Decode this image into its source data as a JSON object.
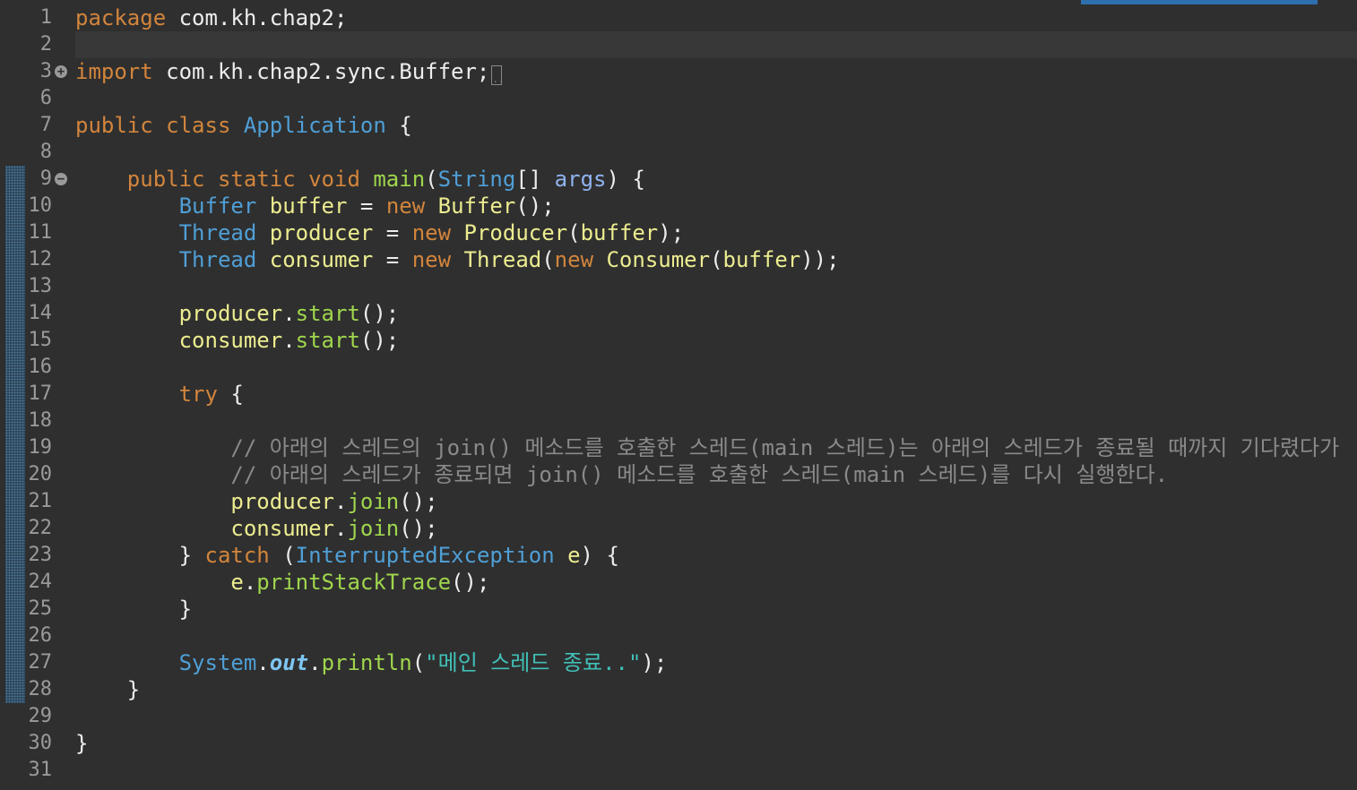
{
  "editor": {
    "colors": {
      "background": "#2f2f2f",
      "keyword": "#d2853c",
      "type": "#4f9fd6",
      "variable": "#ecec90",
      "method": "#9fd64d",
      "comment": "#8a8a8a",
      "string": "#40c0b8",
      "line_number": "#9a9a9a"
    },
    "lines": [
      {
        "n": "1",
        "tokens": [
          [
            "kw",
            "package"
          ],
          [
            "plain",
            " com.kh.chap2;"
          ]
        ]
      },
      {
        "n": "2",
        "tokens": [],
        "current": true
      },
      {
        "n": "3",
        "fold": "expand",
        "tokens": [
          [
            "kw",
            "import"
          ],
          [
            "plain",
            " com.kh.chap2.sync.Buffer;"
          ],
          [
            "box",
            ".."
          ]
        ]
      },
      {
        "n": "6",
        "tokens": []
      },
      {
        "n": "7",
        "tokens": [
          [
            "kw",
            "public"
          ],
          [
            "plain",
            " "
          ],
          [
            "kw",
            "class"
          ],
          [
            "plain",
            " "
          ],
          [
            "type",
            "Application"
          ],
          [
            "plain",
            " {"
          ]
        ]
      },
      {
        "n": "8",
        "tokens": []
      },
      {
        "n": "9",
        "fold": "collapse",
        "change": true,
        "tokens": [
          [
            "plain",
            "    "
          ],
          [
            "kw",
            "public"
          ],
          [
            "plain",
            " "
          ],
          [
            "kw",
            "static"
          ],
          [
            "plain",
            " "
          ],
          [
            "kw",
            "void"
          ],
          [
            "plain",
            " "
          ],
          [
            "method",
            "main"
          ],
          [
            "plain",
            "("
          ],
          [
            "type",
            "String"
          ],
          [
            "plain",
            "[] "
          ],
          [
            "param",
            "args"
          ],
          [
            "plain",
            ") {"
          ]
        ]
      },
      {
        "n": "10",
        "change": true,
        "tokens": [
          [
            "plain",
            "        "
          ],
          [
            "type",
            "Buffer"
          ],
          [
            "plain",
            " "
          ],
          [
            "var",
            "buffer"
          ],
          [
            "plain",
            " = "
          ],
          [
            "kw",
            "new"
          ],
          [
            "plain",
            " "
          ],
          [
            "var",
            "Buffer"
          ],
          [
            "plain",
            "();"
          ]
        ]
      },
      {
        "n": "11",
        "change": true,
        "tokens": [
          [
            "plain",
            "        "
          ],
          [
            "type",
            "Thread"
          ],
          [
            "plain",
            " "
          ],
          [
            "var",
            "producer"
          ],
          [
            "plain",
            " = "
          ],
          [
            "kw",
            "new"
          ],
          [
            "plain",
            " "
          ],
          [
            "var",
            "Producer"
          ],
          [
            "plain",
            "("
          ],
          [
            "var",
            "buffer"
          ],
          [
            "plain",
            ");"
          ]
        ]
      },
      {
        "n": "12",
        "change": true,
        "tokens": [
          [
            "plain",
            "        "
          ],
          [
            "type",
            "Thread"
          ],
          [
            "plain",
            " "
          ],
          [
            "var",
            "consumer"
          ],
          [
            "plain",
            " = "
          ],
          [
            "kw",
            "new"
          ],
          [
            "plain",
            " "
          ],
          [
            "var",
            "Thread"
          ],
          [
            "plain",
            "("
          ],
          [
            "kw",
            "new"
          ],
          [
            "plain",
            " "
          ],
          [
            "var",
            "Consumer"
          ],
          [
            "plain",
            "("
          ],
          [
            "var",
            "buffer"
          ],
          [
            "plain",
            "));"
          ]
        ]
      },
      {
        "n": "13",
        "change": true,
        "tokens": []
      },
      {
        "n": "14",
        "change": true,
        "tokens": [
          [
            "plain",
            "        "
          ],
          [
            "var",
            "producer"
          ],
          [
            "plain",
            "."
          ],
          [
            "method",
            "start"
          ],
          [
            "plain",
            "();"
          ]
        ]
      },
      {
        "n": "15",
        "change": true,
        "tokens": [
          [
            "plain",
            "        "
          ],
          [
            "var",
            "consumer"
          ],
          [
            "plain",
            "."
          ],
          [
            "method",
            "start"
          ],
          [
            "plain",
            "();"
          ]
        ]
      },
      {
        "n": "16",
        "change": true,
        "tokens": []
      },
      {
        "n": "17",
        "change": true,
        "tokens": [
          [
            "plain",
            "        "
          ],
          [
            "kw",
            "try"
          ],
          [
            "plain",
            " {"
          ]
        ]
      },
      {
        "n": "18",
        "change": true,
        "tokens": []
      },
      {
        "n": "19",
        "change": true,
        "tokens": [
          [
            "plain",
            "            "
          ],
          [
            "comment",
            "// 아래의 스레드의 join() 메소드를 호출한 스레드(main 스레드)는 아래의 스레드가 종료될 때까지 기다렸다가"
          ]
        ]
      },
      {
        "n": "20",
        "change": true,
        "tokens": [
          [
            "plain",
            "            "
          ],
          [
            "comment",
            "// 아래의 스레드가 종료되면 join() 메소드를 호출한 스레드(main 스레드)를 다시 실행한다."
          ]
        ]
      },
      {
        "n": "21",
        "change": true,
        "tokens": [
          [
            "plain",
            "            "
          ],
          [
            "var",
            "producer"
          ],
          [
            "plain",
            "."
          ],
          [
            "method",
            "join"
          ],
          [
            "plain",
            "();"
          ]
        ]
      },
      {
        "n": "22",
        "change": true,
        "tokens": [
          [
            "plain",
            "            "
          ],
          [
            "var",
            "consumer"
          ],
          [
            "plain",
            "."
          ],
          [
            "method",
            "join"
          ],
          [
            "plain",
            "();"
          ]
        ]
      },
      {
        "n": "23",
        "change": true,
        "tokens": [
          [
            "plain",
            "        } "
          ],
          [
            "kw",
            "catch"
          ],
          [
            "plain",
            " ("
          ],
          [
            "type",
            "InterruptedException"
          ],
          [
            "plain",
            " "
          ],
          [
            "var",
            "e"
          ],
          [
            "plain",
            ") {"
          ]
        ]
      },
      {
        "n": "24",
        "change": true,
        "tokens": [
          [
            "plain",
            "            "
          ],
          [
            "var",
            "e"
          ],
          [
            "plain",
            "."
          ],
          [
            "method",
            "printStackTrace"
          ],
          [
            "plain",
            "();"
          ]
        ]
      },
      {
        "n": "25",
        "change": true,
        "tokens": [
          [
            "plain",
            "        }"
          ]
        ]
      },
      {
        "n": "26",
        "change": true,
        "tokens": []
      },
      {
        "n": "27",
        "change": true,
        "tokens": [
          [
            "plain",
            "        "
          ],
          [
            "type",
            "System"
          ],
          [
            "plain",
            "."
          ],
          [
            "field",
            "out"
          ],
          [
            "plain",
            "."
          ],
          [
            "method",
            "println"
          ],
          [
            "plain",
            "("
          ],
          [
            "string",
            "\"메인 스레드 종료..\""
          ],
          [
            "plain",
            ");"
          ]
        ]
      },
      {
        "n": "28",
        "change": true,
        "tokens": [
          [
            "plain",
            "    }"
          ]
        ]
      },
      {
        "n": "29",
        "tokens": []
      },
      {
        "n": "30",
        "tokens": [
          [
            "plain",
            "}"
          ]
        ]
      },
      {
        "n": "31",
        "tokens": []
      }
    ]
  }
}
